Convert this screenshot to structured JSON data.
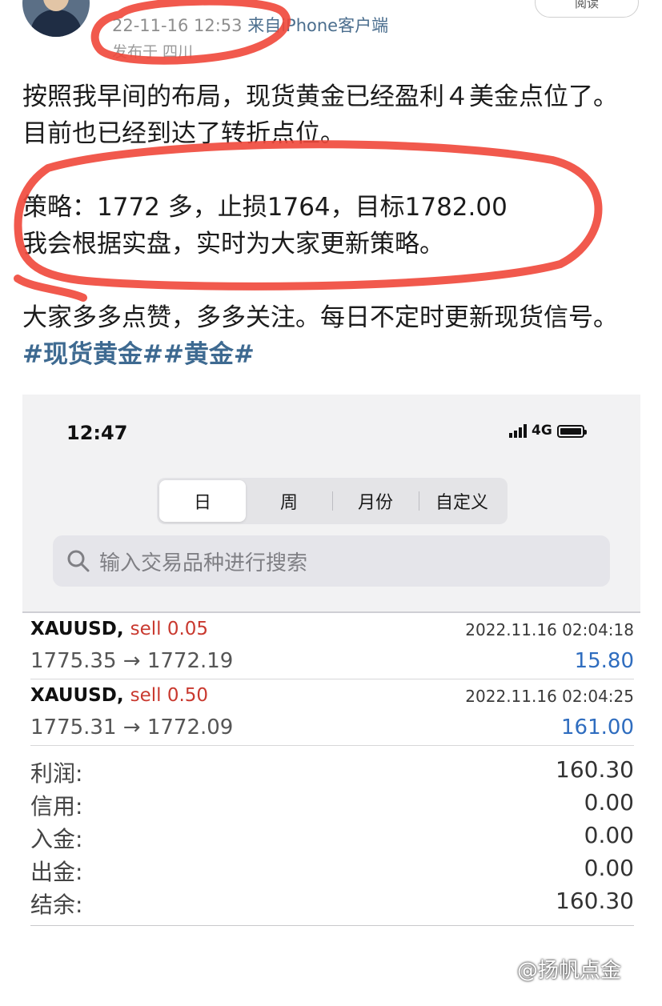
{
  "post": {
    "date": "22-11-16 12:53",
    "source": "来自iPhone客户端",
    "location": "发布于 四川",
    "read_button": "阅读",
    "para1": "按照我早间的布局，现货黄金已经盈利４美金点位了。目前也已经到达了转折点位。",
    "para2_line1": "策略：1772 多，止损1764，目标1782.00",
    "para2_line2": "我会根据实盘，实时为大家更新策略。",
    "para3": "大家多多点赞，多多关注。每日不定时更新现货信号。",
    "hashtags": "#现货黄金##黄金#"
  },
  "phone": {
    "status_time": "12:47",
    "network": "4G",
    "tabs": [
      "日",
      "周",
      "月份",
      "自定义"
    ],
    "search_placeholder": "输入交易品种进行搜索",
    "deals": [
      {
        "symbol": "XAUUSD,",
        "side": "sell 0.05",
        "time": "2022.11.16 02:04:18",
        "prices": "1775.35 → 1772.19",
        "profit": "15.80"
      },
      {
        "symbol": "XAUUSD,",
        "side": "sell 0.50",
        "time": "2022.11.16 02:04:25",
        "prices": "1775.31 → 1772.09",
        "profit": "161.00"
      }
    ],
    "summary": [
      {
        "label": "利润:",
        "value": "160.30"
      },
      {
        "label": "信用:",
        "value": "0.00"
      },
      {
        "label": "入金:",
        "value": "0.00"
      },
      {
        "label": "出金:",
        "value": "0.00"
      },
      {
        "label": "结余:",
        "value": "160.30"
      }
    ]
  },
  "watermark": "@扬帆点金",
  "colors": {
    "annotation": "#f0473a",
    "sell": "#c9392f",
    "profit": "#2f6dbf",
    "hashtag": "#3e6a91"
  }
}
